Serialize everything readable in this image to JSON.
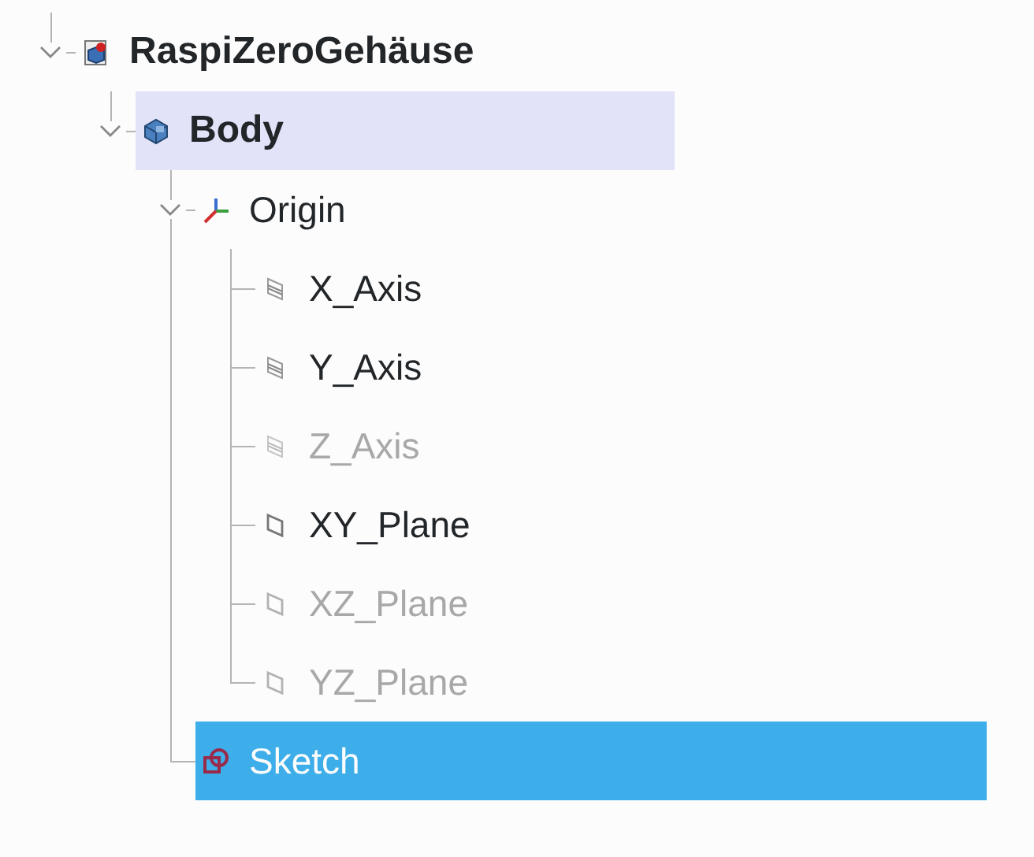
{
  "tree": {
    "items": [
      {
        "label": "RaspiZeroGehäuse",
        "kind": "document",
        "expanded": true,
        "active": true,
        "visible": true,
        "hovered": false,
        "selected": false,
        "children": [
          {
            "label": "Body",
            "kind": "body",
            "expanded": true,
            "active": true,
            "visible": true,
            "hovered": true,
            "selected": false,
            "children": [
              {
                "label": "Origin",
                "kind": "origin",
                "expanded": true,
                "active": false,
                "visible": true,
                "hovered": false,
                "selected": false,
                "children": [
                  {
                    "label": "X_Axis",
                    "kind": "axis",
                    "active": false,
                    "visible": true,
                    "hovered": false,
                    "selected": false
                  },
                  {
                    "label": "Y_Axis",
                    "kind": "axis",
                    "active": false,
                    "visible": true,
                    "hovered": false,
                    "selected": false
                  },
                  {
                    "label": "Z_Axis",
                    "kind": "axis",
                    "active": false,
                    "visible": false,
                    "hovered": false,
                    "selected": false
                  },
                  {
                    "label": "XY_Plane",
                    "kind": "plane",
                    "active": false,
                    "visible": true,
                    "hovered": false,
                    "selected": false
                  },
                  {
                    "label": "XZ_Plane",
                    "kind": "plane",
                    "active": false,
                    "visible": false,
                    "hovered": false,
                    "selected": false
                  },
                  {
                    "label": "YZ_Plane",
                    "kind": "plane",
                    "active": false,
                    "visible": false,
                    "hovered": false,
                    "selected": false
                  }
                ]
              },
              {
                "label": "Sketch",
                "kind": "sketch",
                "active": false,
                "visible": true,
                "hovered": false,
                "selected": true
              }
            ]
          }
        ]
      }
    ]
  }
}
